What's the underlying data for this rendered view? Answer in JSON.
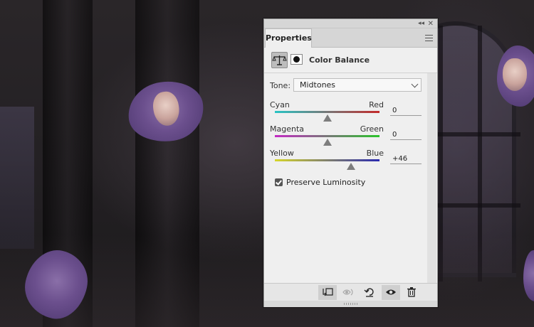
{
  "panel": {
    "tab_label": "Properties",
    "adjustment_title": "Color Balance",
    "tone": {
      "label": "Tone:",
      "selected": "Midtones"
    },
    "sliders": [
      {
        "left_label": "Cyan",
        "right_label": "Red",
        "value": "0",
        "position": 0.5,
        "left_color": "#29c4c4",
        "right_color": "#c42a2a"
      },
      {
        "left_label": "Magenta",
        "right_label": "Green",
        "value": "0",
        "position": 0.5,
        "left_color": "#c42ac4",
        "right_color": "#2ac42a"
      },
      {
        "left_label": "Yellow",
        "right_label": "Blue",
        "value": "+46",
        "position": 0.73,
        "left_color": "#d6d62a",
        "right_color": "#2a2ab0"
      }
    ],
    "preserve_luminosity": {
      "label": "Preserve Luminosity",
      "checked": true
    },
    "footer_buttons": [
      "clip-to-layer-icon",
      "view-previous-state-icon",
      "reset-icon",
      "visibility-eye-icon",
      "trash-icon"
    ]
  }
}
